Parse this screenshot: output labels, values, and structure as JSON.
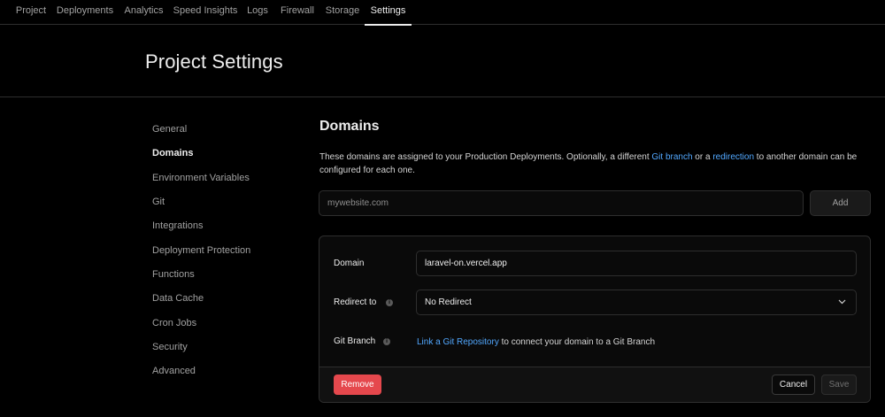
{
  "topnav": {
    "tabs": [
      {
        "label": "Project"
      },
      {
        "label": "Deployments"
      },
      {
        "label": "Analytics"
      },
      {
        "label": "Speed Insights"
      },
      {
        "label": "Logs"
      },
      {
        "label": "Firewall"
      },
      {
        "label": "Storage"
      },
      {
        "label": "Settings"
      }
    ],
    "active": "Settings"
  },
  "header": {
    "title": "Project Settings"
  },
  "sidebar": {
    "items": [
      {
        "label": "General"
      },
      {
        "label": "Domains"
      },
      {
        "label": "Environment Variables"
      },
      {
        "label": "Git"
      },
      {
        "label": "Integrations"
      },
      {
        "label": "Deployment Protection"
      },
      {
        "label": "Functions"
      },
      {
        "label": "Data Cache"
      },
      {
        "label": "Cron Jobs"
      },
      {
        "label": "Security"
      },
      {
        "label": "Advanced"
      }
    ],
    "active": "Domains"
  },
  "domains": {
    "title": "Domains",
    "description": {
      "part1": "These domains are assigned to your Production Deployments. Optionally, a different ",
      "link1": "Git branch",
      "part2": " or a ",
      "link2": "redirection",
      "part3": " to another domain can be configured for each one."
    },
    "input_placeholder": "mywebsite.com",
    "add_label": "Add"
  },
  "card": {
    "domain_label": "Domain",
    "domain_value": "laravel-on.vercel.app",
    "redirect_label": "Redirect to",
    "redirect_value": "No Redirect",
    "git_label": "Git Branch",
    "git_link": "Link a Git Repository",
    "git_text": " to connect your domain to a Git Branch",
    "remove_label": "Remove",
    "cancel_label": "Cancel",
    "save_label": "Save"
  },
  "colors": {
    "background": "#000000",
    "accent_link": "#52a8ff",
    "danger": "#e5484d"
  },
  "icons": {
    "info": "info-icon",
    "chevron": "chevron-down-icon"
  }
}
